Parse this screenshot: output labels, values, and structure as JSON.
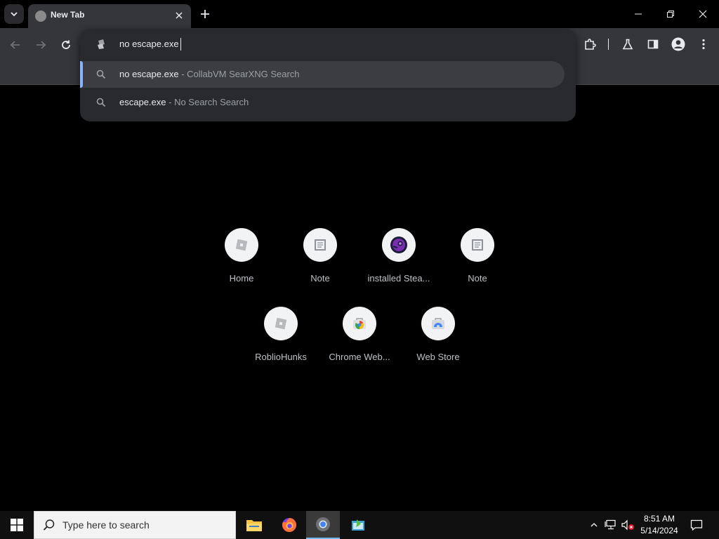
{
  "tab": {
    "title": "New Tab"
  },
  "omnibox": {
    "value": "no escape.exe",
    "suggestions": [
      {
        "query": "no escape.exe",
        "separator": " - ",
        "engine": "CollabVM SearXNG Search",
        "selected": true
      },
      {
        "query": "escape.exe",
        "separator": " - ",
        "engine": "No Search Search",
        "selected": false
      }
    ]
  },
  "shortcuts": {
    "items": [
      {
        "label": "Home",
        "icon": "roblox-icon"
      },
      {
        "label": "Note",
        "icon": "note-icon"
      },
      {
        "label": "installed Stea...",
        "icon": "steam-icon"
      },
      {
        "label": "Note",
        "icon": "note-icon"
      },
      {
        "label": "RoblioHunks",
        "icon": "roblox-icon"
      },
      {
        "label": "Chrome Web...",
        "icon": "chrome-web-store-icon"
      },
      {
        "label": "Web Store",
        "icon": "web-store-icon"
      }
    ]
  },
  "toolbar": {
    "back_icon": "back-arrow-icon",
    "forward_icon": "forward-arrow-icon",
    "reload_icon": "reload-icon",
    "extensions_icon": "puzzle-icon",
    "labs_icon": "flask-icon",
    "sidepanel_icon": "side-panel-icon",
    "profile_icon": "profile-icon",
    "menu_icon": "kebab-menu-icon"
  },
  "taskbar": {
    "search_placeholder": "Type here to search",
    "time": "8:51 AM",
    "date": "5/14/2024"
  },
  "colors": {
    "accent": "#8ab4f8",
    "toolbar_bg": "#35363a",
    "dropdown_bg": "#292a2d",
    "page_bg": "#000000"
  }
}
